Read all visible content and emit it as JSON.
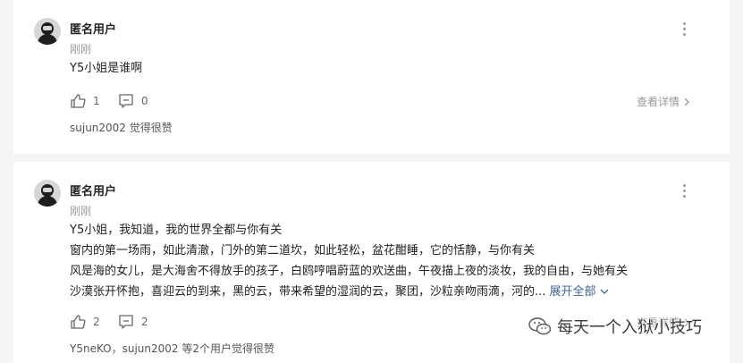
{
  "comments": [
    {
      "username": "匿名用户",
      "time": "刚刚",
      "lines": [
        "Y5小姐是谁啊"
      ],
      "likes": "1",
      "replies": "0",
      "detail_label": "查看详情",
      "liked_by": "sujun2002 觉得很赞"
    },
    {
      "username": "匿名用户",
      "time": "刚刚",
      "lines": [
        "Y5小姐，我知道，我的世界全都与你有关",
        "窗内的第一场雨，如此清澈，门外的第二道坎，如此轻松，盆花酣睡，它的恬静，与你有关",
        "风是海的女儿，是大海舍不得放手的孩子，白鸥哼唱蔚蓝的欢送曲，午夜描上夜的淡妆，我的自由，与她有关",
        "沙漠张开怀抱，喜迎云的到来，黑的云，带来希望的湿润的云，聚团，沙粒亲吻雨滴，河的..."
      ],
      "expand_label": "展开全部",
      "likes": "2",
      "replies": "2",
      "detail_label": "查看详情",
      "liked_by": "Y5neKO，sujun2002 等2个用户觉得很赞"
    }
  ],
  "watermark": "每天一个入狱小技巧"
}
